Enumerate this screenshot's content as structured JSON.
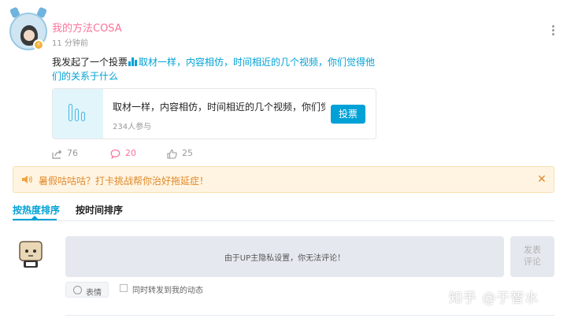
{
  "post": {
    "user_name": "我的方法COSA",
    "time": "11 分钟前",
    "text_prefix": "我发起了一个投票",
    "text_link": "取材一样，内容相仿，时间相近的几个视频，你们觉得他们的关系于什么",
    "vote_card": {
      "title": "取材一样，内容相仿，时间相近的几个视频，你们觉...",
      "participants": "234人参与",
      "button_label": "投票"
    },
    "actions": {
      "share_count": "76",
      "comment_count": "20",
      "like_count": "25"
    },
    "colors": {
      "accent": "#00a1d6",
      "pink": "#fb7299",
      "notice": "#e08a2c"
    },
    "icons": {
      "more": "more-vertical-icon",
      "share": "share-icon",
      "comment": "comment-icon",
      "like": "thumbs-up-icon"
    }
  },
  "notice": {
    "text": "暑假咕咕咕？打卡挑战帮你治好拖延症！",
    "icon": "speaker-icon",
    "close_icon": "close-icon",
    "close_glyph": "✕"
  },
  "sort_tabs": [
    {
      "label": "按热度排序",
      "active": true
    },
    {
      "label": "按时间排序",
      "active": false
    }
  ],
  "comment_form": {
    "disabled_text": "由于UP主隐私设置，你无法评论！",
    "publish_label_line1": "发表",
    "publish_label_line2": "评论",
    "emoji_label": "表情",
    "repost_label": "同时转发到我的动态"
  },
  "watermark": "知乎 @于智水"
}
